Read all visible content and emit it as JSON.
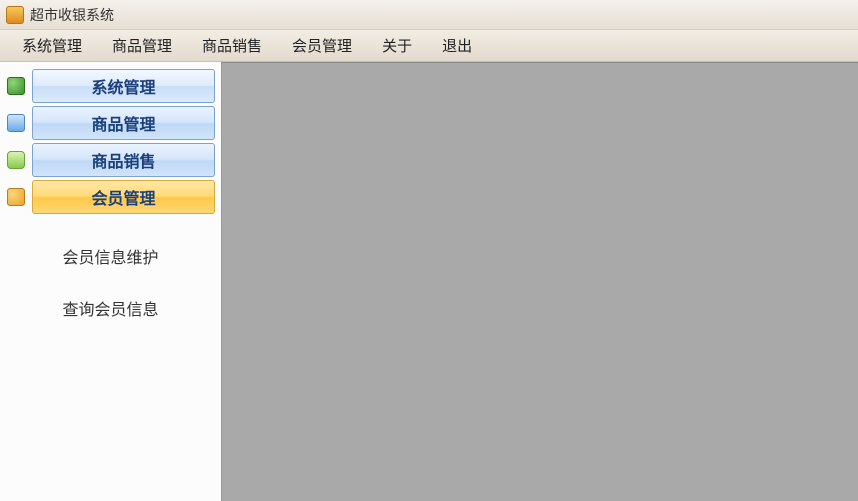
{
  "window": {
    "title": "超市收银系统"
  },
  "menu": {
    "items": [
      "系统管理",
      "商品管理",
      "商品销售",
      "会员管理",
      "关于",
      "退出"
    ]
  },
  "sidebar": {
    "sections": [
      {
        "label": "系统管理",
        "style": "blue first",
        "icon": "users-icon"
      },
      {
        "label": "商品管理",
        "style": "blue",
        "icon": "device-icon"
      },
      {
        "label": "商品销售",
        "style": "blue",
        "icon": "phone-icon"
      },
      {
        "label": "会员管理",
        "style": "orange",
        "icon": "user-icon"
      }
    ],
    "subitems": [
      "会员信息维护",
      "查询会员信息"
    ]
  }
}
